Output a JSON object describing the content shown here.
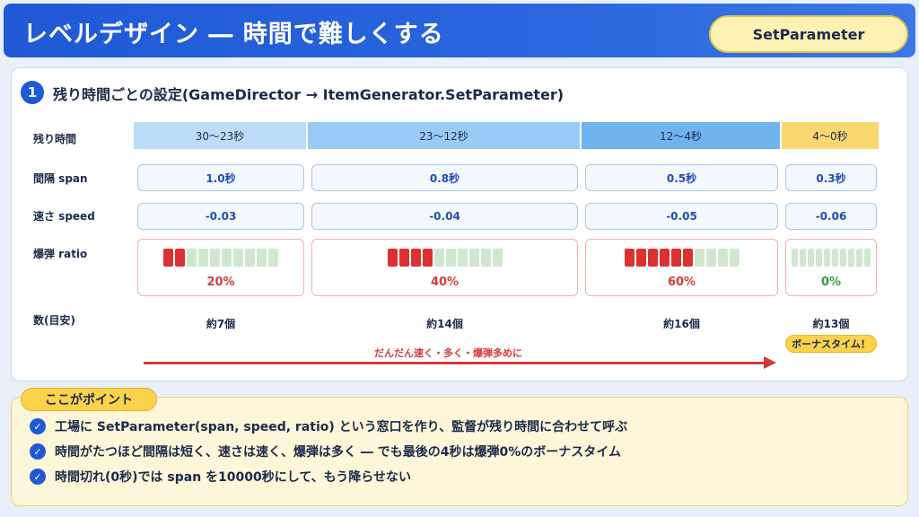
{
  "header": {
    "title": "レベルデザイン ― 時間で難しくする",
    "badge": "SetParameter"
  },
  "section": {
    "number": "1",
    "title": "残り時間ごとの設定(GameDirector → ItemGenerator.SetParameter)"
  },
  "rows": {
    "time_label": "残り時間",
    "span_label": "間隔 span",
    "speed_label": "速さ speed",
    "ratio_label": "爆弾 ratio",
    "count_label": "数(目安)"
  },
  "phases": [
    {
      "time": "30〜23秒",
      "span": "1.0秒",
      "speed": "-0.03",
      "ratio": "20%",
      "ratio_value": 0.2,
      "count": "約7個"
    },
    {
      "time": "23〜12秒",
      "span": "0.8秒",
      "speed": "-0.04",
      "ratio": "40%",
      "ratio_value": 0.4,
      "count": "約14個"
    },
    {
      "time": "12〜4秒",
      "span": "0.5秒",
      "speed": "-0.05",
      "ratio": "60%",
      "ratio_value": 0.6,
      "count": "約16個"
    },
    {
      "time": "4〜0秒",
      "span": "0.3秒",
      "speed": "-0.06",
      "ratio": "0%",
      "ratio_value": 0.0,
      "count": "約13個"
    }
  ],
  "arrow_text": "だんだん速く・多く・爆弾多めに",
  "bonus_label": "ボーナスタイム！",
  "colors": {
    "accent": "#1f59d6",
    "bomb": "#dc3131",
    "safe": "#cfe8cd",
    "highlight": "#fbd24a"
  },
  "points": {
    "tag": "ここがポイント",
    "items": [
      "工場に SetParameter(span, speed, ratio) という窓口を作り、監督が残り時間に合わせて呼ぶ",
      "時間がたつほど間隔は短く、速さは速く、爆弾は多く ― でも最後の4秒は爆弾0%のボーナスタイム",
      "時間切れ(0秒)では span を10000秒にして、もう降らせない"
    ]
  }
}
